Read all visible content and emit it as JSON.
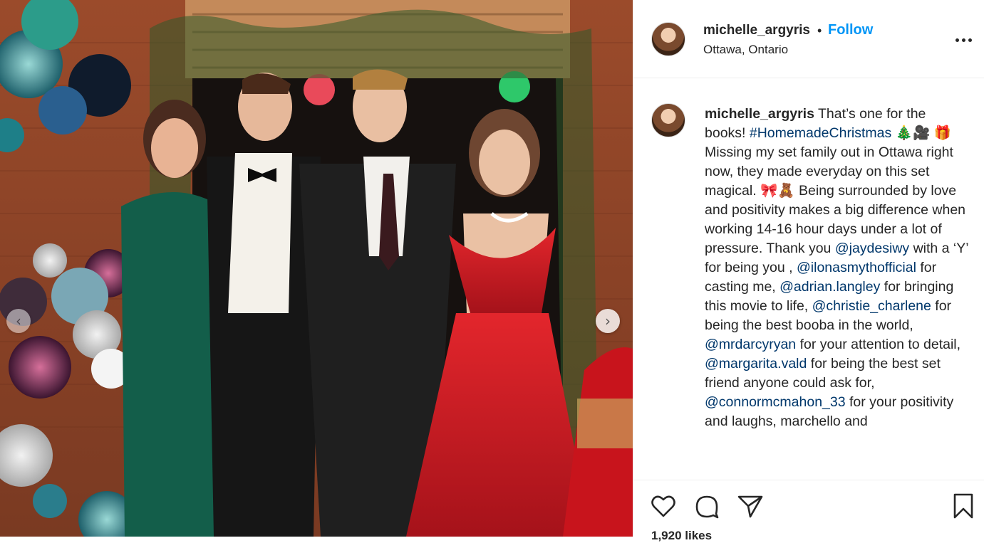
{
  "header": {
    "username": "michelle_argyris",
    "separator": "•",
    "follow_label": "Follow",
    "location": "Ottawa, Ontario"
  },
  "caption": {
    "username": "michelle_argyris",
    "segments": [
      {
        "t": "text",
        "v": " That’s one for the books! "
      },
      {
        "t": "tag",
        "v": "#HomemadeChristmas"
      },
      {
        "t": "text",
        "v": " 🎄🎥 🎁 Missing my set family out in Ottawa right now, they made everyday on this set magical. 🎀🧸 Being surrounded by love and positivity makes a big difference when working 14-16 hour days under a lot of pressure. Thank you "
      },
      {
        "t": "tag",
        "v": "@jaydesiwy"
      },
      {
        "t": "text",
        "v": " with a ‘Y’ for being you , "
      },
      {
        "t": "tag",
        "v": "@ilonasmythofficial"
      },
      {
        "t": "text",
        "v": " for casting me, "
      },
      {
        "t": "tag",
        "v": "@adrian.langley"
      },
      {
        "t": "text",
        "v": " for bringing this movie to life, "
      },
      {
        "t": "tag",
        "v": "@christie_charlene"
      },
      {
        "t": "text",
        "v": " for being the best booba in the world, "
      },
      {
        "t": "tag",
        "v": "@mrdarcyryan"
      },
      {
        "t": "text",
        "v": " for your attention to detail, "
      },
      {
        "t": "tag",
        "v": "@margarita.vald"
      },
      {
        "t": "text",
        "v": " for being the best set friend anyone could ask for, "
      },
      {
        "t": "tag",
        "v": "@connormcmahon_33"
      },
      {
        "t": "text",
        "v": " for your positivity and laughs, marchello and"
      }
    ]
  },
  "actions": {
    "likes_label": "1,920 likes"
  },
  "icons": {
    "like": "heart-icon",
    "comment": "comment-icon",
    "share": "paper-plane-icon",
    "save": "bookmark-icon",
    "more": "more-options-icon",
    "prev": "chevron-left-icon",
    "next": "chevron-right-icon"
  },
  "colors": {
    "follow": "#0095f6",
    "mention": "#00376b",
    "text": "#262626"
  }
}
